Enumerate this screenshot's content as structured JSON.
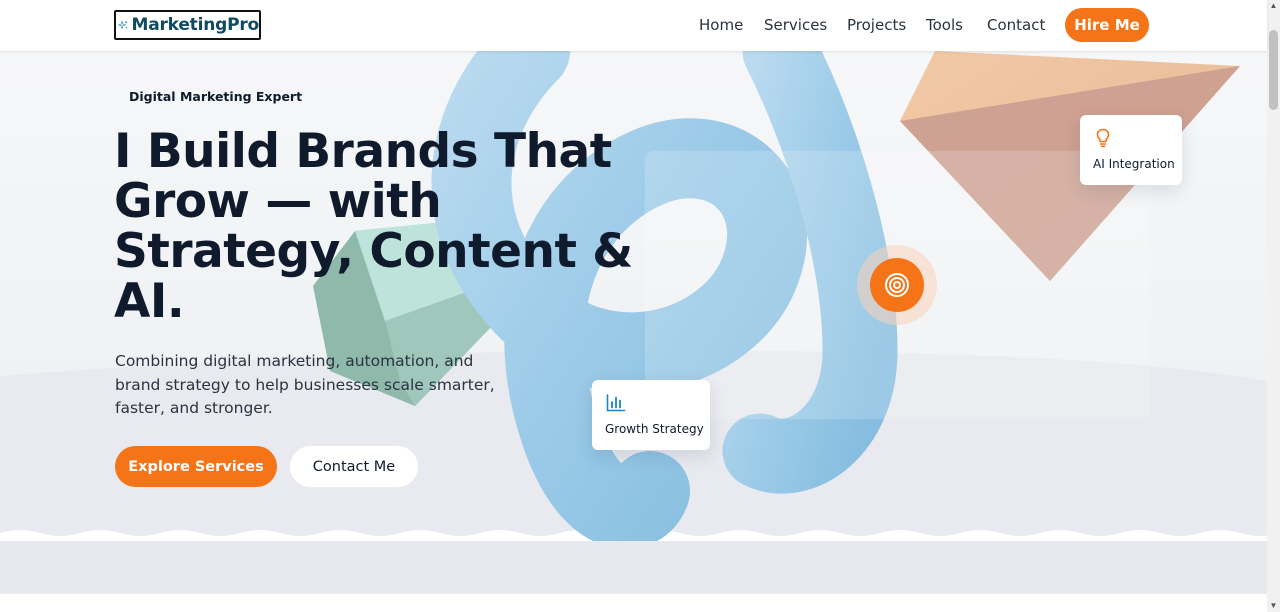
{
  "nav": {
    "logo_text": "MarketingPro",
    "links": [
      {
        "label": "Home"
      },
      {
        "label": "Services"
      },
      {
        "label": "Projects"
      },
      {
        "label": "Tools"
      },
      {
        "label": "Contact"
      }
    ],
    "cta_label": "Hire Me"
  },
  "hero": {
    "eyebrow": "Digital Marketing Expert",
    "headline_lines": [
      "I Build Brands That",
      "Grow — with",
      "Strategy, Content &",
      "AI."
    ],
    "subtext": "Combining digital marketing, automation, and brand strategy to help businesses scale smarter, faster, and stronger.",
    "primary_cta": "Explore Services",
    "secondary_cta": "Contact Me",
    "cards": {
      "ai": {
        "label": "AI Integration",
        "icon": "lightbulb-icon"
      },
      "growth": {
        "label": "Growth Strategy",
        "icon": "bar-chart-icon"
      }
    },
    "target_icon": "target-icon",
    "scroll_icon": "chevron-down-icon"
  },
  "colors": {
    "accent": "#f57417",
    "brand_text": "#0e4a63",
    "heading": "#0f1b2d",
    "icon_blue": "#1b84c4"
  }
}
